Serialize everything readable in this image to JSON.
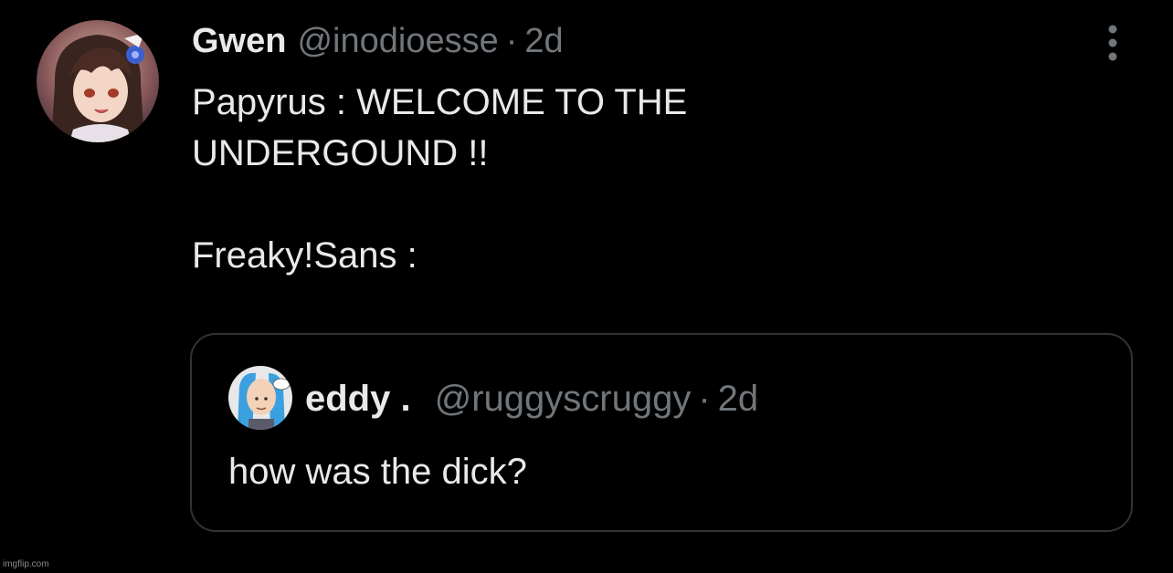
{
  "tweet": {
    "author_name": "Gwen",
    "author_handle": "@inodioesse",
    "separator": "·",
    "time": "2d",
    "text_lines": [
      "Papyrus : WELCOME TO THE",
      "UNDERGOUND !!",
      "",
      "Freaky!Sans :"
    ],
    "more_icon": "more-vertical-icon",
    "avatar": "anime-girl-avatar"
  },
  "quote": {
    "author_name": "eddy .",
    "author_handle": "@ruggyscruggy",
    "separator": "·",
    "time": "2d",
    "text": "how was the dick?",
    "avatar": "cartoon-character-avatar"
  },
  "watermark": "imgflip.com",
  "colors": {
    "background": "#000000",
    "primary_text": "#e7e9ea",
    "secondary_text": "#71767b",
    "border": "#2f3336"
  }
}
